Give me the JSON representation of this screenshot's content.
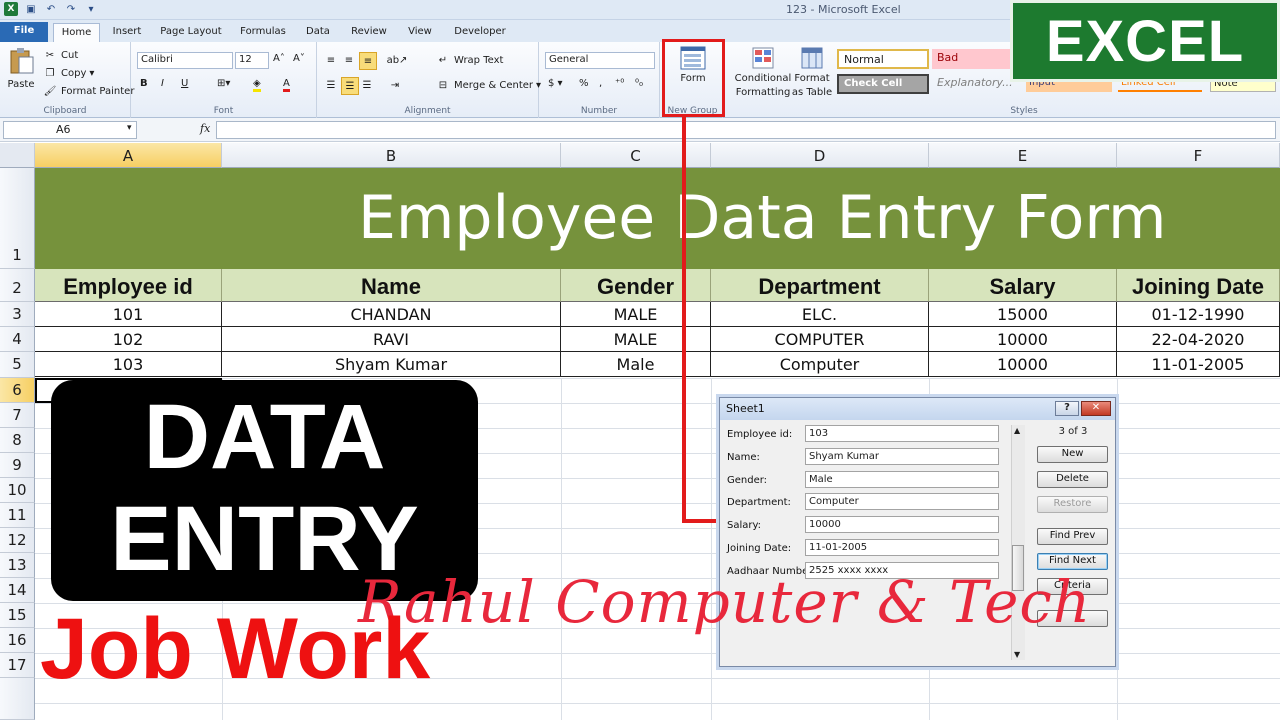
{
  "window": {
    "title": "123 - Microsoft Excel"
  },
  "tabs": [
    "File",
    "Home",
    "Insert",
    "Page Layout",
    "Formulas",
    "Data",
    "Review",
    "View",
    "Developer"
  ],
  "ribbon": {
    "clipboard": {
      "paste": "Paste",
      "cut": "Cut",
      "copy": "Copy",
      "format_painter": "Format Painter",
      "label": "Clipboard"
    },
    "font": {
      "name": "Calibri",
      "size": "12",
      "bold": "B",
      "italic": "I",
      "underline": "U",
      "label": "Font"
    },
    "alignment": {
      "wrap": "Wrap Text",
      "merge": "Merge & Center",
      "label": "Alignment"
    },
    "number": {
      "format": "General",
      "label": "Number"
    },
    "new_group": {
      "form": "Form",
      "label": "New Group"
    },
    "styles_cmds": {
      "conditional": "Conditional",
      "formatting": "Formatting",
      "format_as": "Format",
      "as_table": "as Table"
    },
    "styles": {
      "normal": "Normal",
      "bad": "Bad",
      "check_cell": "Check Cell",
      "explanatory": "Explanatory...",
      "input": "Input",
      "linked_cell": "Linked Cell",
      "note": "Note",
      "label": "Styles"
    }
  },
  "badge": "EXCEL",
  "formula_bar": {
    "name_box": "A6",
    "fx": "fx"
  },
  "columns": [
    "A",
    "B",
    "C",
    "D",
    "E",
    "F"
  ],
  "rows": [
    "1",
    "2",
    "3",
    "4",
    "5",
    "6",
    "7",
    "8",
    "9",
    "10",
    "11",
    "12",
    "13",
    "14",
    "15",
    "16",
    "17"
  ],
  "sheet": {
    "title": "Employee Data Entry Form",
    "headers": [
      "Employee id",
      "Name",
      "Gender",
      "Department",
      "Salary",
      "Joining Date"
    ],
    "records": [
      [
        "101",
        "CHANDAN",
        "MALE",
        "ELC.",
        "15000",
        "01-12-1990"
      ],
      [
        "102",
        "RAVI",
        "MALE",
        "COMPUTER",
        "10000",
        "22-04-2020"
      ],
      [
        "103",
        "Shyam Kumar",
        "Male",
        "Computer",
        "10000",
        "11-01-2005"
      ]
    ]
  },
  "overlay": {
    "data_entry_line1": "DATA",
    "data_entry_line2": "ENTRY",
    "job_work": "Job Work",
    "signature": "Rahul Computer & Tech"
  },
  "dialog": {
    "title": "Sheet1",
    "help": "?",
    "close": "✕",
    "counter": "3 of 3",
    "fields": [
      {
        "label": "Employee id:",
        "value": "103"
      },
      {
        "label": "Name:",
        "value": "Shyam Kumar"
      },
      {
        "label": "Gender:",
        "value": "Male"
      },
      {
        "label": "Department:",
        "value": "Computer"
      },
      {
        "label": "Salary:",
        "value": "10000"
      },
      {
        "label": "Joining Date:",
        "value": "11-01-2005"
      },
      {
        "label": "Aadhaar Number:",
        "value": "2525 xxxx xxxx"
      }
    ],
    "buttons": [
      "New",
      "Delete",
      "Restore",
      "Find Prev",
      "Find Next",
      "Criteria"
    ]
  },
  "colors": {
    "title_fill": "#76923c",
    "header_fill": "#d7e4bc",
    "accent_red": "#e21b1b",
    "excel_green": "#1d7a2f"
  }
}
